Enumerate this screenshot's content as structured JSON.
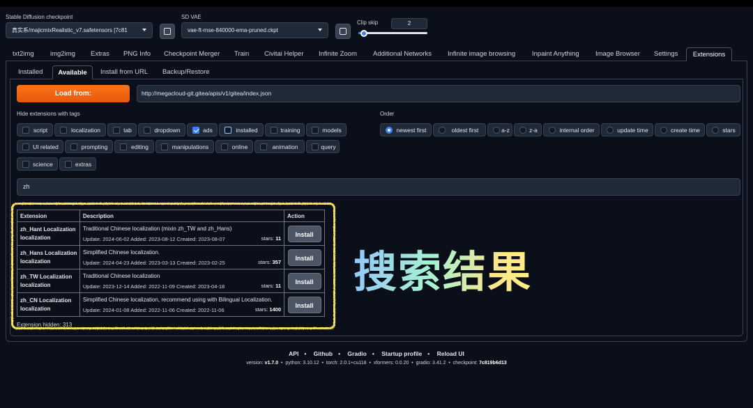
{
  "header": {
    "checkpoint_label": "Stable Diffusion checkpoint",
    "checkpoint_value": "真实系/majicmixRealistic_v7.safetensors [7c81",
    "vae_label": "SD VAE",
    "vae_value": "vae-ft-mse-840000-ema-pruned.ckpt",
    "clip_skip_label": "Clip skip",
    "clip_skip_value": "2",
    "clip_skip_fraction": 0.08
  },
  "tabs": [
    "txt2img",
    "img2img",
    "Extras",
    "PNG Info",
    "Checkpoint Merger",
    "Train",
    "Civitai Helper",
    "Infinite Zoom",
    "Additional Networks",
    "Infinite image browsing",
    "Inpaint Anything",
    "Image Browser",
    "Settings",
    "Extensions"
  ],
  "subtabs": [
    "Installed",
    "Available",
    "Install from URL",
    "Backup/Restore"
  ],
  "load_from_label": "Load from:",
  "index_url": "http://megacloud-git.gitea/apis/v1/gitea/index.json",
  "hide_tags_label": "Hide extensions with tags",
  "tags": [
    {
      "label": "script",
      "checked": false
    },
    {
      "label": "localization",
      "checked": false
    },
    {
      "label": "tab",
      "checked": false
    },
    {
      "label": "dropdown",
      "checked": false
    },
    {
      "label": "ads",
      "checked": true
    },
    {
      "label": "installed",
      "checked": false
    },
    {
      "label": "training",
      "checked": false
    },
    {
      "label": "models",
      "checked": false
    },
    {
      "label": "UI related",
      "checked": false
    },
    {
      "label": "prompting",
      "checked": false
    },
    {
      "label": "editing",
      "checked": false
    },
    {
      "label": "manipulations",
      "checked": false
    },
    {
      "label": "online",
      "checked": false
    },
    {
      "label": "animation",
      "checked": false
    },
    {
      "label": "query",
      "checked": false
    },
    {
      "label": "science",
      "checked": false
    },
    {
      "label": "extras",
      "checked": false
    }
  ],
  "order_label": "Order",
  "order_options": [
    {
      "label": "newest first",
      "selected": true
    },
    {
      "label": "oldest first",
      "selected": false
    },
    {
      "label": "a-z",
      "selected": false
    },
    {
      "label": "z-a",
      "selected": false
    },
    {
      "label": "internal order",
      "selected": false
    },
    {
      "label": "update time",
      "selected": false
    },
    {
      "label": "create time",
      "selected": false
    },
    {
      "label": "stars",
      "selected": false
    }
  ],
  "search_value": "zh",
  "table": {
    "headers": [
      "Extension",
      "Description",
      "Action"
    ],
    "stars_prefix": "stars:",
    "rows": [
      {
        "name": "zh_Hant Localization",
        "tag": "localization",
        "description": "Traditional Chinese localization (mixin zh_TW and zh_Hans)",
        "meta": "Update: 2024-06-02 Added: 2023-08-12 Created: 2023-08-07",
        "stars": "11",
        "action": "Install"
      },
      {
        "name": "zh_Hans Localization",
        "tag": "localization",
        "description": "Simplified Chinese localization.",
        "meta": "Update: 2024-04-23 Added: 2023-03-13 Created: 2023-02-25",
        "stars": "357",
        "action": "Install"
      },
      {
        "name": "zh_TW Localization",
        "tag": "localization",
        "description": "Traditional Chinese localization",
        "meta": "Update: 2023-12-14 Added: 2022-11-09 Created: 2023-04-18",
        "stars": "11",
        "action": "Install"
      },
      {
        "name": "zh_CN Localization",
        "tag": "localization",
        "description": "Simplified Chinese localization, recommend using with Bilingual Localization.",
        "meta": "Update: 2024-01-08 Added: 2022-11-06 Created: 2022-11-06",
        "stars": "1400",
        "action": "Install"
      }
    ]
  },
  "extensions_hidden": "Extension hidden: 313",
  "annotation": "搜索结果",
  "footer": {
    "links": [
      "API",
      "Github",
      "Gradio",
      "Startup profile",
      "Reload UI"
    ],
    "version_parts": [
      {
        "k": "version:",
        "v": "v1.7.0"
      },
      {
        "k": "python:",
        "v": "3.10.12"
      },
      {
        "k": "torch:",
        "v": "2.0.1+cu118"
      },
      {
        "k": "xformers:",
        "v": "0.0.20"
      },
      {
        "k": "gradio:",
        "v": "3.41.2"
      },
      {
        "k": "checkpoint:",
        "v": "7c819b6d13"
      }
    ]
  }
}
